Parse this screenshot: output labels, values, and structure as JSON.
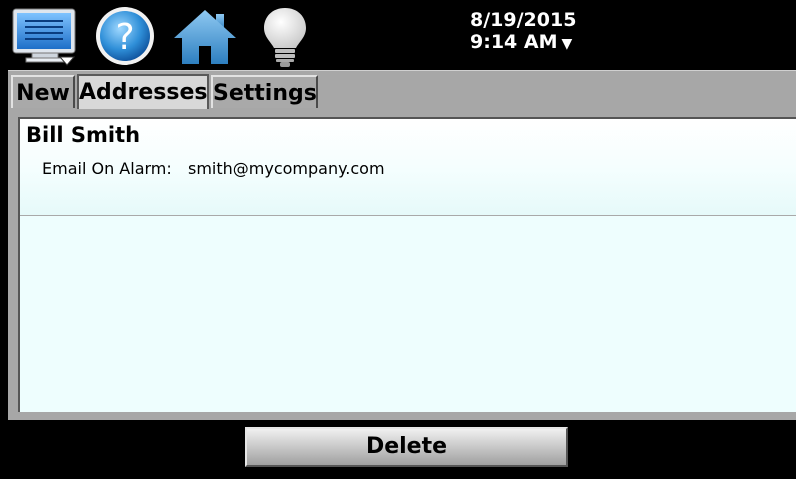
{
  "header": {
    "icons": [
      "monitor-menu-icon",
      "help-icon",
      "home-icon",
      "lightbulb-icon"
    ],
    "date": "8/19/2015",
    "time": "9:14 AM",
    "time_arrow": "▼"
  },
  "tabs": [
    {
      "label": "New",
      "active": false
    },
    {
      "label": "Addresses",
      "active": true
    },
    {
      "label": "Settings",
      "active": false
    }
  ],
  "entries": [
    {
      "name": "Bill Smith",
      "email_label": "Email On Alarm:",
      "email": "smith@mycompany.com"
    }
  ],
  "actions": {
    "delete_label": "Delete"
  },
  "colors": {
    "panel": "#eefefe",
    "background": "#000000",
    "frame": "#a7a7a7",
    "icon_blue": "#2f8fd8"
  }
}
